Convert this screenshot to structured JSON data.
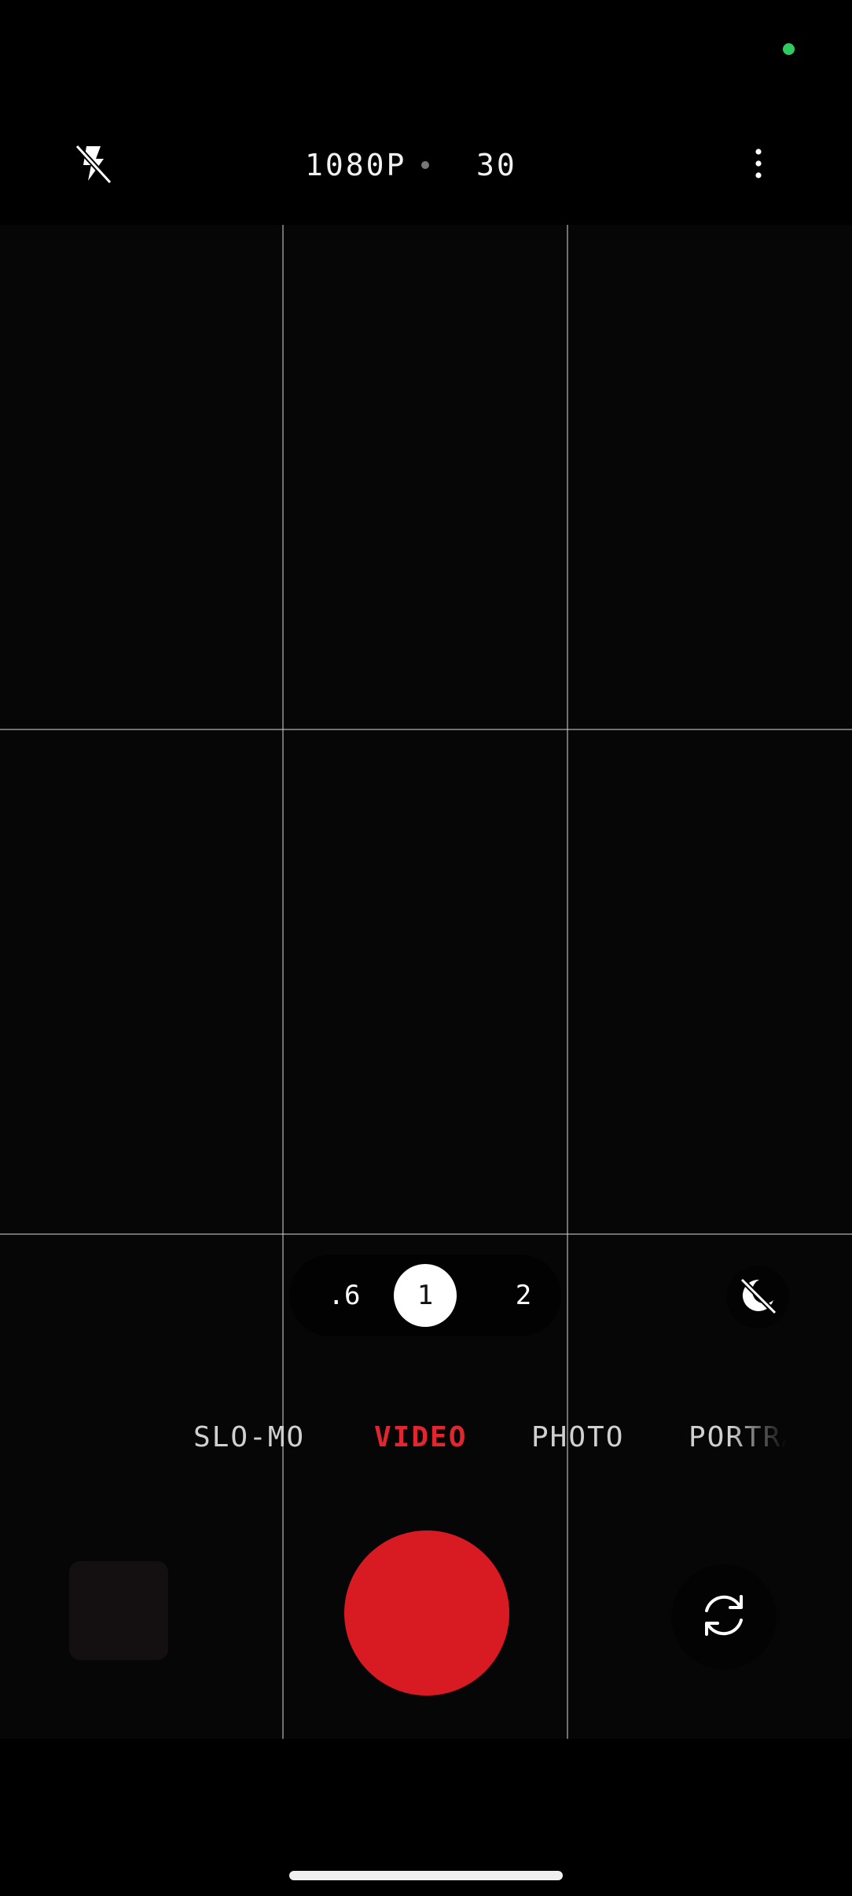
{
  "status_bar": {
    "privacy_indicator_color": "#2ecc5e"
  },
  "top_bar": {
    "flash_icon": "flash-off-icon",
    "resolution": "1080P",
    "frame_rate": "30",
    "more_icon": "more-vertical-icon"
  },
  "viewfinder": {
    "grid": "3x3"
  },
  "zoom": {
    "options": [
      ".6",
      "1",
      "2"
    ],
    "selected": "1"
  },
  "night_mode_icon": "night-mode-off-icon",
  "modes": {
    "items": [
      "SLO-MO",
      "VIDEO",
      "PHOTO",
      "PORTRAIT"
    ],
    "active": "VIDEO",
    "accent_color": "#e0262e"
  },
  "controls": {
    "shutter_color": "#d81a22",
    "switch_camera_icon": "switch-camera-icon",
    "gallery_thumbnail": "gallery-thumbnail"
  }
}
